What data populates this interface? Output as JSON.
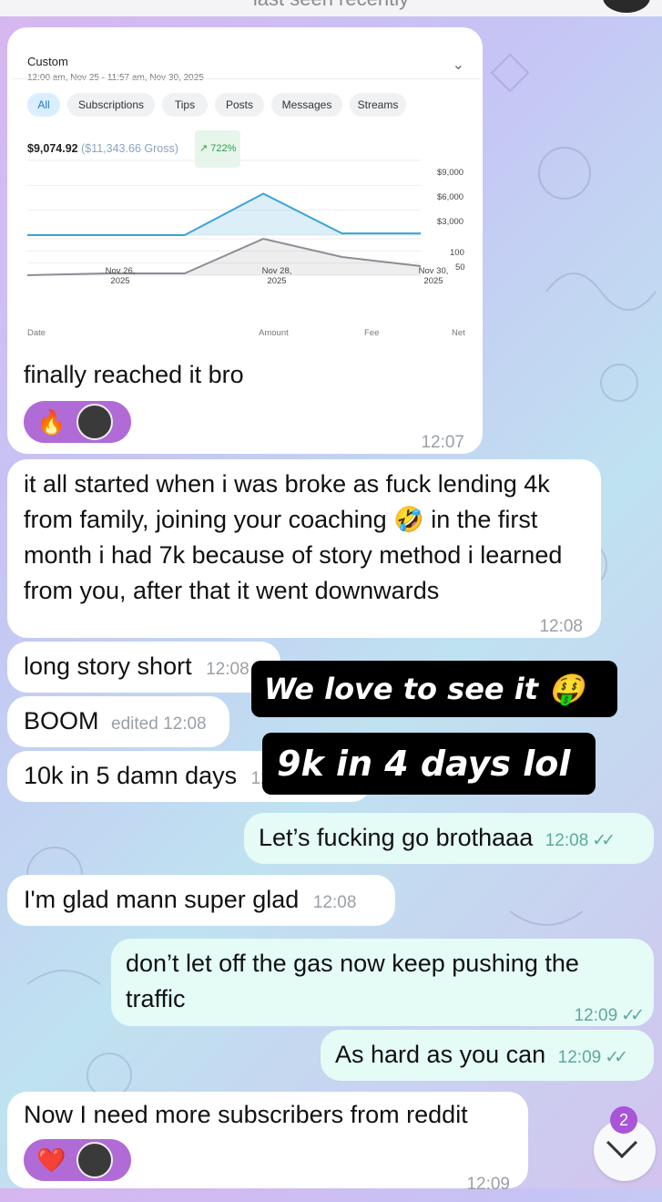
{
  "header": {
    "status": "last seen recently"
  },
  "card": {
    "title": "Custom",
    "range": "12:00 am, Nov 25 - 11:57 am, Nov 30, 2025",
    "tabs": [
      "All",
      "Subscriptions",
      "Tips",
      "Posts",
      "Messages",
      "Streams"
    ],
    "net": "$9,074.92",
    "gross": "($11,343.66 Gross)",
    "change": "↗ 722%",
    "columns": [
      "Date",
      "Amount",
      "Fee",
      "Net"
    ]
  },
  "chart_data": [
    {
      "type": "area",
      "title": "",
      "x": [
        "Nov 25, 2025",
        "Nov 26, 2025",
        "Nov 27, 2025",
        "Nov 28, 2025",
        "Nov 29, 2025",
        "Nov 30, 2025"
      ],
      "x_tick_labels": [
        "Nov 26,\n2025",
        "Nov 28,\n2025",
        "Nov 30,\n2025"
      ],
      "series": [
        {
          "values": [
            0,
            0,
            0,
            5000,
            200,
            200
          ]
        }
      ],
      "y_tick_labels": [
        "$9,000",
        "$6,000",
        "$3,000"
      ],
      "ylim": [
        0,
        9000
      ],
      "color": "#3ba3d8"
    },
    {
      "type": "area",
      "series": [
        {
          "values": [
            0,
            5,
            5,
            100,
            50,
            25
          ]
        }
      ],
      "y_tick_labels": [
        "100",
        "50"
      ],
      "ylim": [
        0,
        100
      ],
      "color": "#8a8f96"
    }
  ],
  "messages": [
    {
      "text": "finally reached it bro",
      "time": "12:07",
      "reaction": "🔥"
    },
    {
      "text": "it all started when i was broke as fuck lending 4k from family, joining your coaching 🤣 in the first month i had 7k because of story method i learned from you, after that it went downwards",
      "time": "12:08"
    },
    {
      "text": "long story short",
      "time": "12:08"
    },
    {
      "text": "BOOM",
      "time": "edited 12:08"
    },
    {
      "text": "10k in 5 damn days",
      "time": "12:08"
    },
    {
      "text": "Let’s fucking go brothaaa",
      "time": "12:08"
    },
    {
      "text": "I'm glad mann super glad",
      "time": "12:08"
    },
    {
      "text": "don’t let off the gas now keep pushing the traffic",
      "time": "12:09"
    },
    {
      "text": "As hard as you can",
      "time": "12:09"
    },
    {
      "text": "Now I need more subscribers from reddit",
      "time": "12:09",
      "reaction": "❤️"
    }
  ],
  "stickers": [
    "We love to see it 🤑",
    "9k in 4 days lol"
  ],
  "unread_count": "2",
  "colors": {
    "outgoing": "#e4fbf6",
    "incoming": "#ffffff",
    "reaction": "#b06bd6",
    "accent": "#a855d8"
  }
}
